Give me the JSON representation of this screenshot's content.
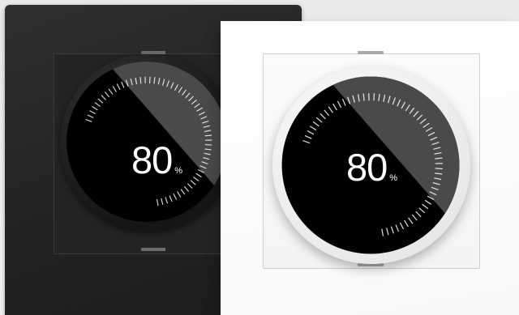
{
  "switches": [
    {
      "finish": "dark",
      "value": "80",
      "unit": "%",
      "level": 0.8,
      "colors": {
        "plate": "#242425",
        "screen": "#000000",
        "highlight": "#4a4a4b",
        "ticks": "#ffffff"
      }
    },
    {
      "finish": "white",
      "value": "80",
      "unit": "%",
      "level": 0.8,
      "colors": {
        "plate": "#f7f7f7",
        "screen": "#000000",
        "highlight": "#4a4a4b",
        "ticks": "#ffffff"
      }
    }
  ]
}
